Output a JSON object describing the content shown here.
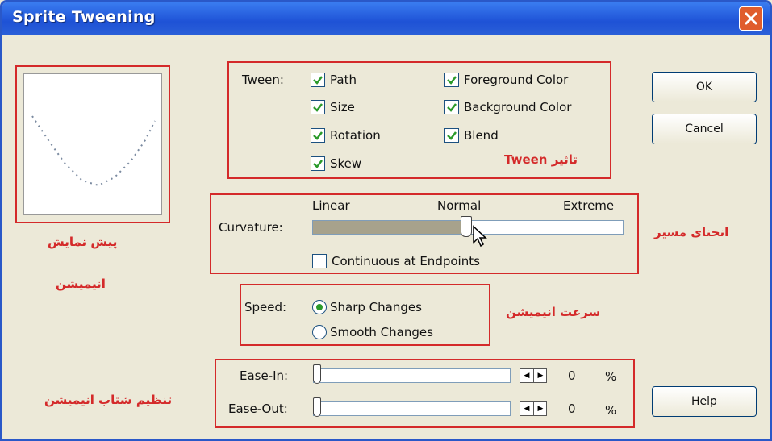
{
  "window": {
    "title": "Sprite Tweening",
    "close_icon": "close-icon"
  },
  "tween": {
    "label": "Tween:",
    "options": [
      {
        "label": "Path",
        "checked": true
      },
      {
        "label": "Size",
        "checked": true
      },
      {
        "label": "Rotation",
        "checked": true
      },
      {
        "label": "Skew",
        "checked": true
      },
      {
        "label": "Foreground Color",
        "checked": true
      },
      {
        "label": "Background Color",
        "checked": true
      },
      {
        "label": "Blend",
        "checked": true
      }
    ]
  },
  "curvature": {
    "label": "Curvature:",
    "scale": {
      "left": "Linear",
      "middle": "Normal",
      "right": "Extreme"
    },
    "value_fraction": 0.5,
    "continuous_label": "Continuous at Endpoints",
    "continuous_checked": false
  },
  "speed": {
    "label": "Speed:",
    "options": [
      {
        "label": "Sharp Changes",
        "selected": true
      },
      {
        "label": "Smooth Changes",
        "selected": false
      }
    ]
  },
  "ease": {
    "in": {
      "label": "Ease-In:",
      "value": "0",
      "unit": "%"
    },
    "out": {
      "label": "Ease-Out:",
      "value": "0",
      "unit": "%"
    }
  },
  "buttons": {
    "ok": "OK",
    "cancel": "Cancel",
    "help": "Help"
  },
  "annotations": {
    "preview_line1": "پیش نمایش",
    "preview_line2": "انیمیشن",
    "tween": "تاثیر Tween",
    "curvature": "انحنای مسیر",
    "speed": "سرعت انیمیشن",
    "ease": "تنظیم شتاب انیمیشن"
  },
  "colors": {
    "accent_red": "#d42a2a",
    "titlebar_blue": "#1e52d6",
    "check_green": "#2a9a2a"
  }
}
